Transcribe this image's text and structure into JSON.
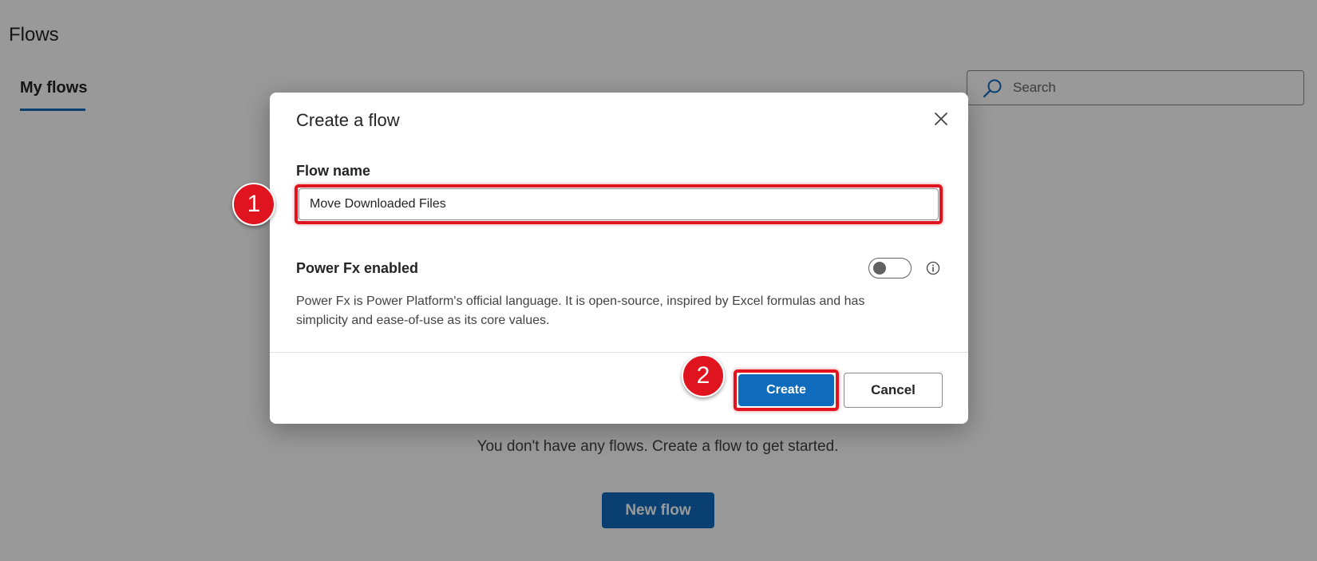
{
  "page": {
    "title": "Flows",
    "tab_label": "My flows",
    "search_placeholder": "Search",
    "empty_message": "You don't have any flows. Create a flow to get started.",
    "new_flow_label": "New flow"
  },
  "dialog": {
    "title": "Create a flow",
    "flow_name_label": "Flow name",
    "flow_name_value": "Move Downloaded Files",
    "power_fx_label": "Power Fx enabled",
    "power_fx_enabled": false,
    "power_fx_description": "Power Fx is Power Platform's official language. It is open-source, inspired by Excel formulas and has simplicity and ease-of-use as its core values.",
    "create_label": "Create",
    "cancel_label": "Cancel"
  },
  "annotations": {
    "marker_1": "1",
    "marker_2": "2"
  },
  "icons": [
    "search-icon",
    "close-icon",
    "info-icon"
  ],
  "colors": {
    "accent": "#0f6cbd",
    "highlight": "#e0141e",
    "overlay": "rgba(0,0,0,0.4)"
  }
}
